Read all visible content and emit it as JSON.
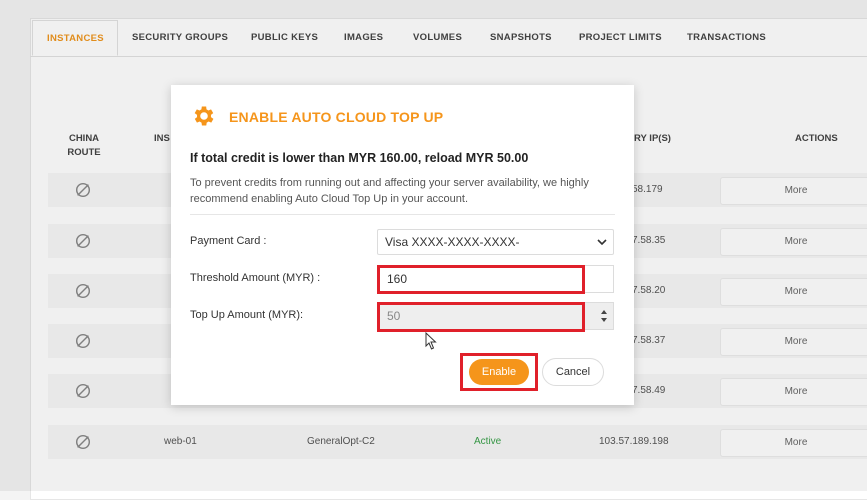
{
  "tabs": [
    {
      "label": "INSTANCES",
      "active": true
    },
    {
      "label": "SECURITY GROUPS"
    },
    {
      "label": "PUBLIC KEYS"
    },
    {
      "label": "IMAGES"
    },
    {
      "label": "VOLUMES"
    },
    {
      "label": "SNAPSHOTS"
    },
    {
      "label": "PROJECT LIMITS"
    },
    {
      "label": "TRANSACTIONS"
    }
  ],
  "table": {
    "headers": {
      "china_route_1": "CHINA",
      "china_route_2": "ROUTE",
      "instance": "INS",
      "primary_ip": "RY IP(S)",
      "actions": "ACTIONS"
    },
    "rows": [
      {
        "ip": "58.179",
        "action": "More"
      },
      {
        "ip": "7.58.35",
        "action": "More"
      },
      {
        "ip": "7.58.20",
        "action": "More"
      },
      {
        "ip": "7.58.37",
        "action": "More"
      },
      {
        "ip": "7.58.49",
        "action": "More"
      },
      {
        "name": "web-01",
        "flavor": "GeneralOpt-C2",
        "status": "Active",
        "ip": "103.57.189.198",
        "action": "More"
      }
    ]
  },
  "modal": {
    "title": "ENABLE AUTO CLOUD TOP UP",
    "headline": "If total credit is lower than MYR 160.00, reload MYR 50.00",
    "description": "To prevent credits from running out and affecting your server availability, we highly recommend enabling Auto Cloud Top Up in your account.",
    "payment_card_label": "Payment Card :",
    "payment_card_value": "Visa XXXX-XXXX-XXXX-",
    "threshold_label": "Threshold Amount (MYR) :",
    "threshold_value": "160",
    "topup_label": "Top Up Amount (MYR):",
    "topup_value": "50",
    "enable_label": "Enable",
    "cancel_label": "Cancel"
  },
  "colors": {
    "accent": "#f5951b",
    "highlight": "#e0202a",
    "active_status": "#3aa04a"
  }
}
